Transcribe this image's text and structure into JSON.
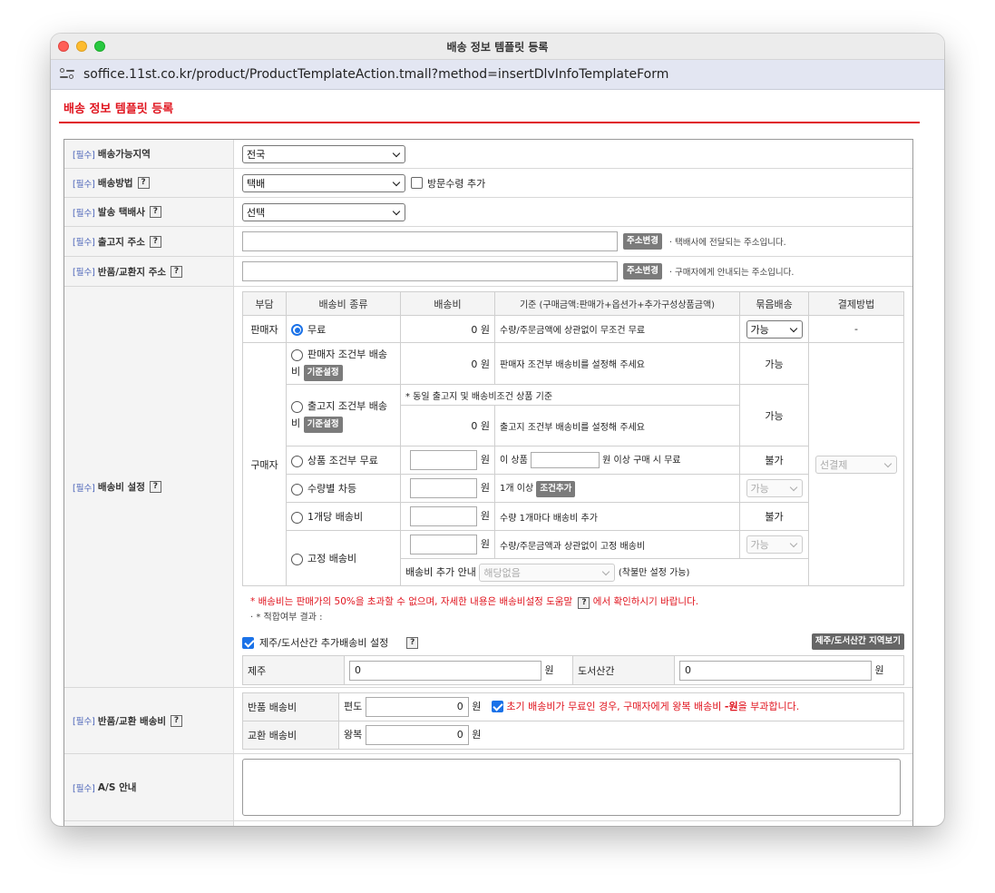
{
  "window": {
    "title": "배송 정보 템플릿 등록",
    "url": "soffice.11st.co.kr/product/ProductTemplateAction.tmall?method=insertDlvInfoTemplateForm"
  },
  "page": {
    "title": "배송 정보 템플릿 등록",
    "required_tag": "[필수]",
    "help": "?"
  },
  "fields": {
    "region": {
      "label": "배송가능지역",
      "value": "전국"
    },
    "method": {
      "label": "배송방법",
      "value": "택배",
      "visit_label": "방문수령 추가"
    },
    "courier": {
      "label": "발송 택배사",
      "value": "선택"
    },
    "origin": {
      "label": "출고지 주소",
      "button": "주소변경",
      "note": "택배사에 전달되는 주소입니다."
    },
    "return_addr": {
      "label": "반품/교환지 주소",
      "button": "주소변경",
      "note": "구매자에게 안내되는 주소입니다."
    },
    "fee": {
      "label": "배송비 설정"
    },
    "return_fee": {
      "label": "반품/교환 배송비"
    },
    "as": {
      "label": "A/S 안내"
    }
  },
  "ship_table": {
    "headers": [
      "부담",
      "배송비 종류",
      "배송비",
      "기준 (구매금액:판매가+옵션가+추가구성상품금액)",
      "묶음배송",
      "결제방법"
    ],
    "seller": "판매자",
    "buyer": "구매자",
    "free": {
      "label": "무료",
      "fee": "0 원",
      "desc": "수량/주문금액에 상관없이 무조건 무료",
      "bundle": "가능",
      "pay": "-"
    },
    "seller_cond": {
      "label": "판매자 조건부 배송",
      "label2": "비",
      "btn": "기준설정",
      "fee": "0 원",
      "desc": "판매자 조건부 배송비를 설정해 주세요",
      "bundle": "가능"
    },
    "origin_cond": {
      "label": "출고지 조건부 배송",
      "label2": "비",
      "btn": "기준설정",
      "top_note": "* 동일 출고지 및 배송비조건 상품 기준",
      "fee": "0 원",
      "desc": "출고지 조건부 배송비를 설정해 주세요",
      "bundle": "가능"
    },
    "product_cond": {
      "label": "상품 조건부 무료",
      "unit": "원",
      "desc1": "이 상품",
      "desc2": "원 이상 구매 시 무료",
      "bundle": "불가"
    },
    "qty_diff": {
      "label": "수량별 차등",
      "unit": "원",
      "desc": "1개 이상",
      "btn": "조건추가",
      "bundle": "가능"
    },
    "per_item": {
      "label": "1개당 배송비",
      "unit": "원",
      "desc": "수량 1개마다 배송비 추가",
      "bundle": "불가"
    },
    "fixed": {
      "label": "고정 배송비",
      "unit": "원",
      "desc": "수량/주문금액과 상관없이 고정 배송비",
      "bundle": "가능",
      "extra_label": "배송비 추가 안내",
      "extra_value": "해당없음",
      "extra_note": "(착불만 설정 가능)"
    },
    "pay_method": "선결제"
  },
  "fee_notes": {
    "warn1": "* 배송비는 판매가의 50%을 초과할 수 없으며, 자세한 내용은 배송비설정 도움말",
    "warn2": "에서 확인하시기 바랍니다.",
    "result": "· * 적합여부 결과 :"
  },
  "island": {
    "checkbox_label": "제주/도서산간 추가배송비 설정",
    "button": "제주/도서산간 지역보기",
    "jeju_label": "제주",
    "jeju_value": "0",
    "island_label": "도서산간",
    "island_value": "0",
    "unit": "원"
  },
  "returns": {
    "return_label": "반품 배송비",
    "return_way": "편도",
    "return_value": "0",
    "unit": "원",
    "notice": "초기 배송비가 무료인 경우, 구매자에게 왕복 배송비",
    "notice_bold": "-원",
    "notice_end": "을 부과합니다.",
    "exchange_label": "교환 배송비",
    "exchange_way": "왕복",
    "exchange_value": "0"
  }
}
